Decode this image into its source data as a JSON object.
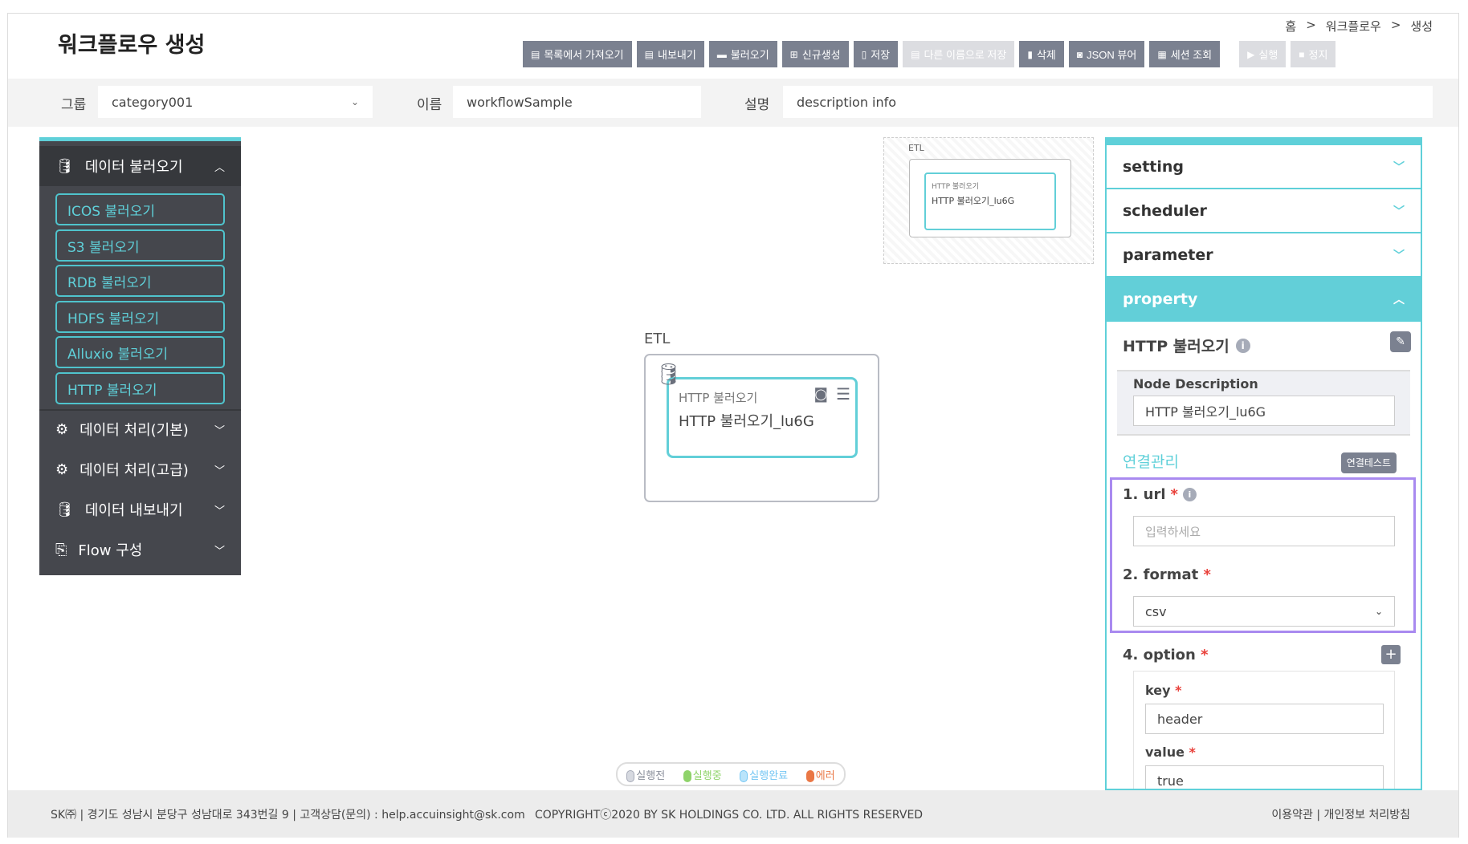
{
  "header": {
    "title": "워크플로우 생성",
    "breadcrumb": [
      "홈",
      "워크플로우",
      "생성"
    ],
    "breadcrumb_sep": ">"
  },
  "toolbar": [
    {
      "label": "목록에서 가져오기",
      "icon": "list-icon",
      "enabled": true
    },
    {
      "label": "내보내기",
      "icon": "export-icon",
      "enabled": true
    },
    {
      "label": "불러오기",
      "icon": "folder-icon",
      "enabled": true
    },
    {
      "label": "신규생성",
      "icon": "plus-square-icon",
      "enabled": true
    },
    {
      "label": "저장",
      "icon": "save-icon",
      "enabled": true
    },
    {
      "label": "다른 이름으로 저장",
      "icon": "save-as-icon",
      "enabled": false
    },
    {
      "label": "삭제",
      "icon": "trash-icon",
      "enabled": true
    },
    {
      "label": "JSON 뷰어",
      "icon": "json-icon",
      "enabled": true
    },
    {
      "label": "세션 조회",
      "icon": "session-search-icon",
      "enabled": true
    },
    {
      "label": "실행",
      "icon": "play-icon",
      "enabled": false
    },
    {
      "label": "정지",
      "icon": "stop-icon",
      "enabled": false
    }
  ],
  "filter": {
    "group_label": "그룹",
    "group_value": "category001",
    "name_label": "이름",
    "name_value": "workflowSample",
    "desc_label": "설명",
    "desc_value": "description info"
  },
  "sidebar": {
    "sections": [
      {
        "label": "데이터 불러오기",
        "icon": "database-import-icon",
        "expanded": true,
        "items": [
          "ICOS 불러오기",
          "S3 불러오기",
          "RDB 불러오기",
          "HDFS 불러오기",
          "Alluxio 불러오기",
          "HTTP 불러오기"
        ]
      },
      {
        "label": "데이터 처리(기본)",
        "icon": "gear-icon",
        "expanded": false
      },
      {
        "label": "데이터 처리(고급)",
        "icon": "gear-icon",
        "expanded": false
      },
      {
        "label": "데이터 내보내기",
        "icon": "database-export-icon",
        "expanded": false
      },
      {
        "label": "Flow 구성",
        "icon": "flow-icon",
        "expanded": false
      }
    ]
  },
  "canvas": {
    "group_label": "ETL",
    "node_type": "HTTP 불러오기",
    "node_name": "HTTP 불러오기_lu6G"
  },
  "legend": [
    {
      "label": "실행전",
      "color": "#a6abb8"
    },
    {
      "label": "실행중",
      "color": "#8fd36a"
    },
    {
      "label": "실행완료",
      "color": "#74c6f3"
    },
    {
      "label": "에러",
      "color": "#ea7745"
    }
  ],
  "panel": {
    "accordions": [
      "setting",
      "scheduler",
      "parameter",
      "property"
    ],
    "node_title": "HTTP 불러오기",
    "node_desc_label": "Node Description",
    "node_desc_value": "HTTP 불러오기_lu6G",
    "conn_title": "연결관리",
    "conn_test": "연결테스트",
    "url_label": "1. url",
    "url_placeholder": "입력하세요",
    "format_label": "2. format",
    "format_value": "csv",
    "option_label": "4. option",
    "key_label": "key",
    "key_value": "header",
    "value_label": "value",
    "value_value": "true",
    "required_mark": "*"
  },
  "footer": {
    "address": "SK㈜ | 경기도 성남시 분당구 성남대로 343번길 9 | 고객상담(문의) : help.accuinsight@sk.com",
    "copyright": "COPYRIGHTⓒ2020 BY SK HOLDINGS CO. LTD. ALL RIGHTS RESERVED",
    "terms": "이용약관 | 개인정보 처리방침"
  },
  "colors": {
    "accent": "#5fd0d9",
    "toolbar": "#7b8190",
    "sidebar": "#45474d",
    "highlight": "#a98af0"
  }
}
